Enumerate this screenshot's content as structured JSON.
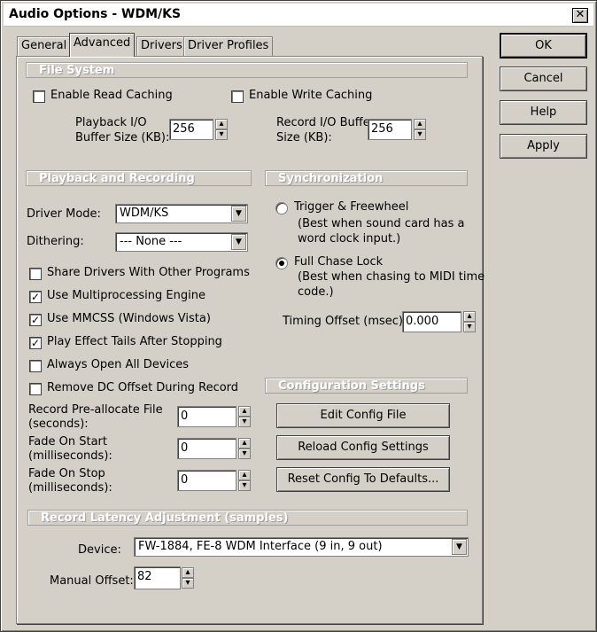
{
  "window": {
    "title": "Audio Options - WDM/KS",
    "close_label": "✕"
  },
  "tabs": [
    {
      "label": "General",
      "active": false
    },
    {
      "label": "Advanced",
      "active": true
    },
    {
      "label": "Drivers",
      "active": false
    },
    {
      "label": "Driver Profiles",
      "active": false
    }
  ],
  "file_system": {
    "header": "File System",
    "read_caching": {
      "label": "Enable Read Caching",
      "checked": false
    },
    "write_caching": {
      "label": "Enable Write Caching",
      "checked": false
    },
    "playback_buffer": {
      "label_line1": "Playback I/O",
      "label_line2": "Buffer Size (KB):",
      "value": "256"
    },
    "record_buffer": {
      "label_line1": "Record I/O Buffer",
      "label_line2": "Size (KB):",
      "value": "256"
    }
  },
  "playback_recording": {
    "header": "Playback and Recording",
    "driver_mode": {
      "label": "Driver Mode:",
      "value": "WDM/KS"
    },
    "dithering": {
      "label": "Dithering:",
      "value": "--- None ---"
    },
    "options": [
      {
        "label": "Share Drivers With Other Programs",
        "checked": false
      },
      {
        "label": "Use Multiprocessing Engine",
        "checked": true
      },
      {
        "label": "Use MMCSS (Windows Vista)",
        "checked": true
      },
      {
        "label": "Play Effect Tails After Stopping",
        "checked": true
      },
      {
        "label": "Always Open All Devices",
        "checked": false
      },
      {
        "label": "Remove DC Offset During Record",
        "checked": false
      }
    ],
    "preallocate": {
      "label_line1": "Record Pre-allocate File",
      "label_line2": "(seconds):",
      "value": "0"
    },
    "fade_start": {
      "label_line1": "Fade On Start",
      "label_line2": "(milliseconds):",
      "value": "0"
    },
    "fade_stop": {
      "label_line1": "Fade On Stop",
      "label_line2": "(milliseconds):",
      "value": "0"
    }
  },
  "synchronization": {
    "header": "Synchronization",
    "trigger": {
      "label": "Trigger & Freewheel",
      "desc_line1": "(Best when sound card has a",
      "desc_line2": "word clock input.)",
      "selected": false
    },
    "chase": {
      "label": "Full Chase Lock",
      "desc_line1": "(Best when chasing to MIDI time",
      "desc_line2": "code.)",
      "selected": true
    },
    "timing_offset": {
      "label": "Timing Offset (msec):",
      "value": "0.000"
    }
  },
  "config": {
    "header": "Configuration Settings",
    "edit": "Edit Config File",
    "reload": "Reload Config Settings",
    "reset": "Reset Config To Defaults..."
  },
  "latency": {
    "header": "Record Latency Adjustment (samples)",
    "device": {
      "label": "Device:",
      "value": "FW-1884, FE-8 WDM Interface (9 in, 9 out)"
    },
    "manual_offset": {
      "label": "Manual Offset:",
      "value": "82"
    }
  },
  "buttons": {
    "ok": "OK",
    "cancel": "Cancel",
    "help": "Help",
    "apply": "Apply"
  }
}
